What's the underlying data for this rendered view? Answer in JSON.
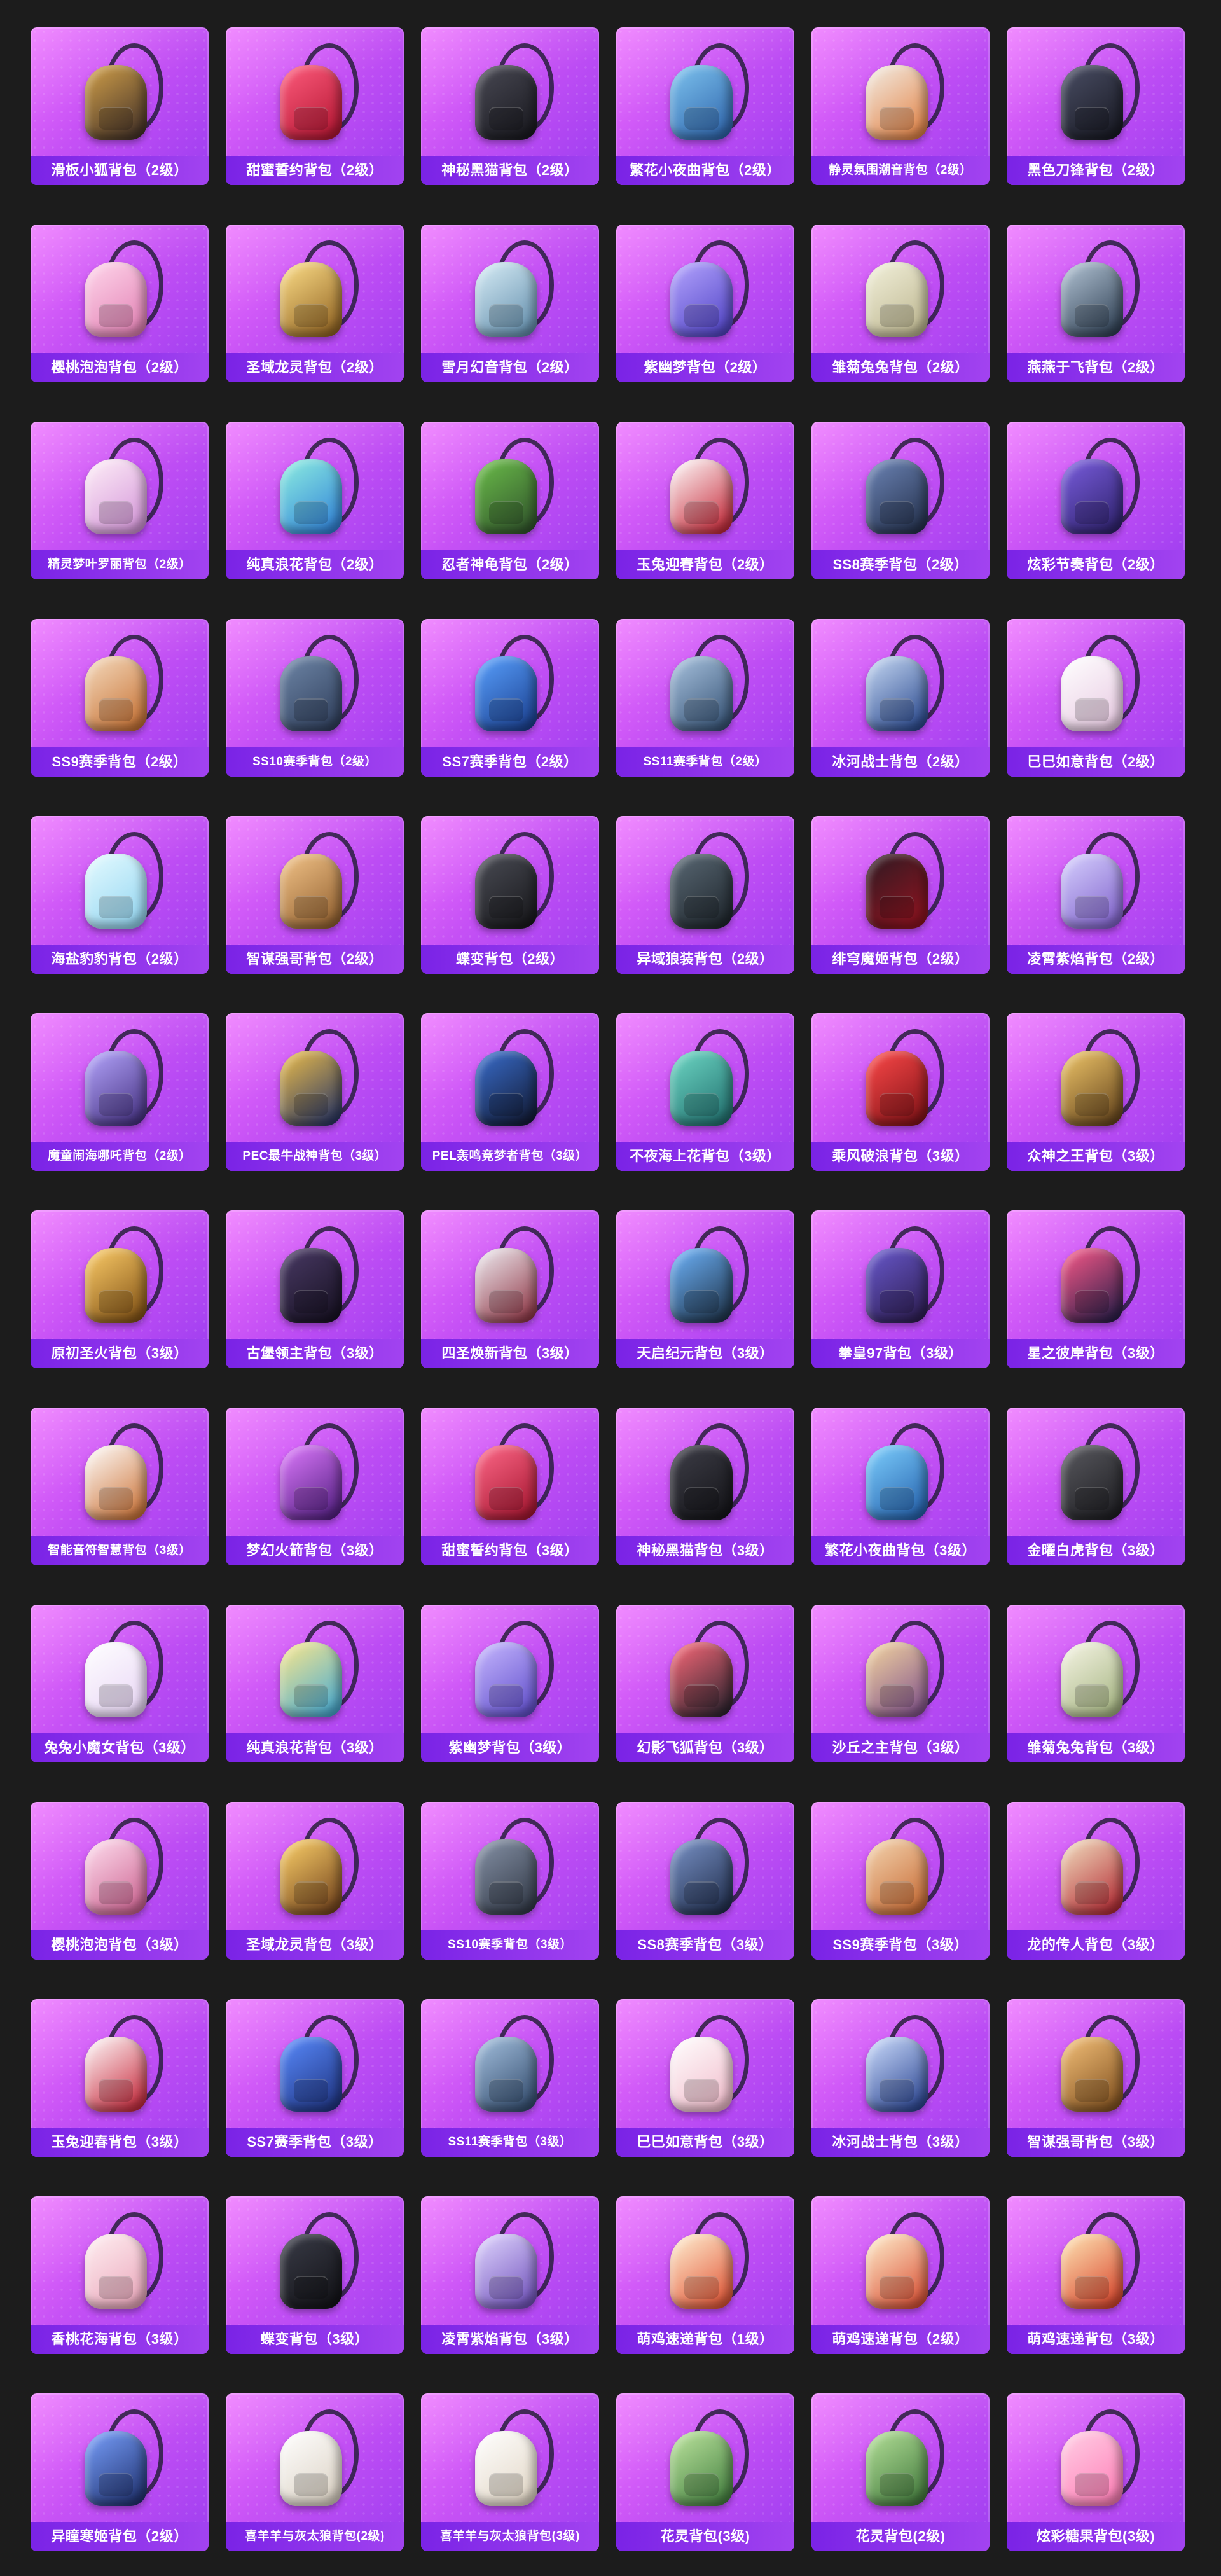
{
  "backpacks": [
    {
      "name": "滑板小狐背包（2级）",
      "c1": "#d4a24a",
      "c2": "#3a2a26"
    },
    {
      "name": "甜蜜誓约背包（2级）",
      "c1": "#ff5d7e",
      "c2": "#b0122e"
    },
    {
      "name": "神秘黑猫背包（2级）",
      "c1": "#4a4a55",
      "c2": "#16161c"
    },
    {
      "name": "繁花小夜曲背包（2级）",
      "c1": "#7fc5f0",
      "c2": "#2a5fa8"
    },
    {
      "name": "静灵氛围潮音背包（2级）",
      "c1": "#f2efe8",
      "c2": "#e27b3a"
    },
    {
      "name": "黑色刀锋背包（2级）",
      "c1": "#4b4f66",
      "c2": "#15161f"
    },
    {
      "name": "樱桃泡泡背包（2级）",
      "c1": "#ffd8ec",
      "c2": "#e07bb0"
    },
    {
      "name": "圣域龙灵背包（2级）",
      "c1": "#ffe08a",
      "c2": "#8a5b1b"
    },
    {
      "name": "雪月幻音背包（2级）",
      "c1": "#d9eef7",
      "c2": "#5b88a8"
    },
    {
      "name": "紫幽梦背包（2级）",
      "c1": "#b6a6ff",
      "c2": "#4a3ec2"
    },
    {
      "name": "雏菊兔兔背包（2级）",
      "c1": "#f3f1dc",
      "c2": "#b9b28a"
    },
    {
      "name": "燕燕于飞背包（2级）",
      "c1": "#b6c7d8",
      "c2": "#25364a"
    },
    {
      "name": "精灵梦叶罗丽背包（2级）",
      "c1": "#fff0f8",
      "c2": "#d18fd7"
    },
    {
      "name": "纯真浪花背包（2级）",
      "c1": "#8ff0e0",
      "c2": "#2b7bd9"
    },
    {
      "name": "忍者神龟背包（2级）",
      "c1": "#6cbf4a",
      "c2": "#2d4d2a"
    },
    {
      "name": "玉兔迎春背包（2级）",
      "c1": "#ffffff",
      "c2": "#c2192a"
    },
    {
      "name": "SS8赛季背包（2级）",
      "c1": "#6e86b8",
      "c2": "#1f2b45"
    },
    {
      "name": "炫彩节奏背包（2级）",
      "c1": "#7b5ee0",
      "c2": "#2a1f66"
    },
    {
      "name": "SS9赛季背包（2级）",
      "c1": "#f5dcc0",
      "c2": "#c46a2a"
    },
    {
      "name": "SS10赛季背包（2级）",
      "c1": "#6f87a8",
      "c2": "#2c3b58"
    },
    {
      "name": "SS7赛季背包（2级）",
      "c1": "#5aa2ff",
      "c2": "#173a8a"
    },
    {
      "name": "SS11赛季背包（2级）",
      "c1": "#aac4e0",
      "c2": "#2e4b6e"
    },
    {
      "name": "冰河战士背包（2级）",
      "c1": "#c9dbf5",
      "c2": "#1f3f88"
    },
    {
      "name": "巳巳如意背包（2级）",
      "c1": "#ffffff",
      "c2": "#e6c6e0"
    },
    {
      "name": "海盐豹豹背包（2级）",
      "c1": "#e6fbff",
      "c2": "#8ed3f0"
    },
    {
      "name": "智谋强哥背包（2级）",
      "c1": "#f4c58a",
      "c2": "#8c5a2a"
    },
    {
      "name": "蝶变背包（2级）",
      "c1": "#4b4d56",
      "c2": "#151518"
    },
    {
      "name": "异域狼装背包（2级）",
      "c1": "#5b6a76",
      "c2": "#1b2228"
    },
    {
      "name": "绯穹魔姬背包（2级）",
      "c1": "#2a1a22",
      "c2": "#9a1320"
    },
    {
      "name": "凌霄紫焰背包（2级）",
      "c1": "#d8d2ff",
      "c2": "#7b5cc9"
    },
    {
      "name": "魔童闹海哪吒背包（2级）",
      "c1": "#b7a8ff",
      "c2": "#3e2a7a"
    },
    {
      "name": "PEC最牛战神背包（3级）",
      "c1": "#f0c04a",
      "c2": "#1b2c66"
    },
    {
      "name": "PEL轰鸣竞梦者背包（3级）",
      "c1": "#3a6fd0",
      "c2": "#10152a"
    },
    {
      "name": "不夜海上花背包（3级）",
      "c1": "#6fd9c6",
      "c2": "#1d6a6a"
    },
    {
      "name": "乘风破浪背包（3级）",
      "c1": "#ff4a4a",
      "c2": "#7a0f14"
    },
    {
      "name": "众神之王背包（3级）",
      "c1": "#f2c86a",
      "c2": "#5c3c18"
    },
    {
      "name": "原初圣火背包（3级）",
      "c1": "#ffcf6a",
      "c2": "#7a4a10"
    },
    {
      "name": "古堡领主背包（3级）",
      "c1": "#4a3a66",
      "c2": "#140f1e"
    },
    {
      "name": "四圣焕新背包（3级）",
      "c1": "#f0f0f5",
      "c2": "#8a2a3a"
    },
    {
      "name": "天启纪元背包（3级）",
      "c1": "#6fb6ff",
      "c2": "#1a2b3e"
    },
    {
      "name": "拳皇97背包（3级）",
      "c1": "#6a5ad0",
      "c2": "#2a1a4a"
    },
    {
      "name": "星之彼岸背包（3级）",
      "c1": "#ff5a8a",
      "c2": "#1a1a45"
    },
    {
      "name": "智能音符智慧背包（3级）",
      "c1": "#ffffff",
      "c2": "#c96a2a"
    },
    {
      "name": "梦幻火箭背包（3级）",
      "c1": "#e07bff",
      "c2": "#4a1a7a"
    },
    {
      "name": "甜蜜誓约背包（3级）",
      "c1": "#ff6a8a",
      "c2": "#a0102a"
    },
    {
      "name": "神秘黑猫背包（3级）",
      "c1": "#3e3e48",
      "c2": "#121216"
    },
    {
      "name": "繁花小夜曲背包（3级）",
      "c1": "#7fd1ff",
      "c2": "#1f5aa8"
    },
    {
      "name": "金曜白虎背包（3级）",
      "c1": "#5a5a60",
      "c2": "#1a1a1e"
    },
    {
      "name": "兔兔小魔女背包（3级）",
      "c1": "#ffffff",
      "c2": "#e7d3f5"
    },
    {
      "name": "纯真浪花背包（3级）",
      "c1": "#ffe88a",
      "c2": "#39a6d9"
    },
    {
      "name": "紫幽梦背包（3级）",
      "c1": "#c8b9ff",
      "c2": "#5a48c9"
    },
    {
      "name": "幻影飞狐背包（3级）",
      "c1": "#ff6a7a",
      "c2": "#1d1f2a"
    },
    {
      "name": "沙丘之主背包（3级）",
      "c1": "#f5d7a0",
      "c2": "#7a4a8a"
    },
    {
      "name": "雏菊兔兔背包（3级）",
      "c1": "#f7f5e6",
      "c2": "#9fb07a"
    },
    {
      "name": "樱桃泡泡背包（3级）",
      "c1": "#ffe0f0",
      "c2": "#c95a8a"
    },
    {
      "name": "圣域龙灵背包（3级）",
      "c1": "#ffd36a",
      "c2": "#6a3a18"
    },
    {
      "name": "SS10赛季背包（3级）",
      "c1": "#8793a8",
      "c2": "#2c3340"
    },
    {
      "name": "SS8赛季背包（3级）",
      "c1": "#7a93c8",
      "c2": "#1b2845"
    },
    {
      "name": "SS9赛季背包（3级）",
      "c1": "#f4d6b2",
      "c2": "#c4622a"
    },
    {
      "name": "龙的传人背包（3级）",
      "c1": "#f2e2c2",
      "c2": "#b01e2a"
    },
    {
      "name": "玉兔迎春背包（3级）",
      "c1": "#ffffff",
      "c2": "#c41a2e"
    },
    {
      "name": "SS7赛季背包（3级）",
      "c1": "#5a8cff",
      "c2": "#1c2f7a"
    },
    {
      "name": "SS11赛季背包（3级）",
      "c1": "#a6c2e0",
      "c2": "#2b4466"
    },
    {
      "name": "巳巳如意背包（3级）",
      "c1": "#ffffff",
      "c2": "#f0b8c8"
    },
    {
      "name": "冰河战士背包（3级）",
      "c1": "#d0e0ff",
      "c2": "#1f3a8a"
    },
    {
      "name": "智谋强哥背包（3级）",
      "c1": "#f6c27a",
      "c2": "#7a4a1a"
    },
    {
      "name": "香桃花海背包（3级）",
      "c1": "#fff0f2",
      "c2": "#e9a2b8"
    },
    {
      "name": "蝶变背包（3级）",
      "c1": "#3a3c48",
      "c2": "#101014"
    },
    {
      "name": "凌霄紫焰背包（3级）",
      "c1": "#e2d8ff",
      "c2": "#6a4ab9"
    },
    {
      "name": "萌鸡速递背包（1级）",
      "c1": "#fff3d6",
      "c2": "#e04a2a"
    },
    {
      "name": "萌鸡速递背包（2级）",
      "c1": "#fff1d0",
      "c2": "#d8452a"
    },
    {
      "name": "萌鸡速递背包（3级）",
      "c1": "#ffe8b8",
      "c2": "#d63a22"
    },
    {
      "name": "异瞳寒姬背包（2级）",
      "c1": "#7aa2ff",
      "c2": "#1a2a66"
    },
    {
      "name": "喜羊羊与灰太狼背包(2级)",
      "c1": "#ffffff",
      "c2": "#d9cfc0"
    },
    {
      "name": "喜羊羊与灰太狼背包(3级)",
      "c1": "#ffffff",
      "c2": "#e0d4c2"
    },
    {
      "name": "花灵背包(3级)",
      "c1": "#bfe6a0",
      "c2": "#3c7a3a"
    },
    {
      "name": "花灵背包(2级)",
      "c1": "#b6e29a",
      "c2": "#3a7236"
    },
    {
      "name": "炫彩糖果背包(3级)",
      "c1": "#ffd0e6",
      "c2": "#ff7ab4"
    }
  ]
}
